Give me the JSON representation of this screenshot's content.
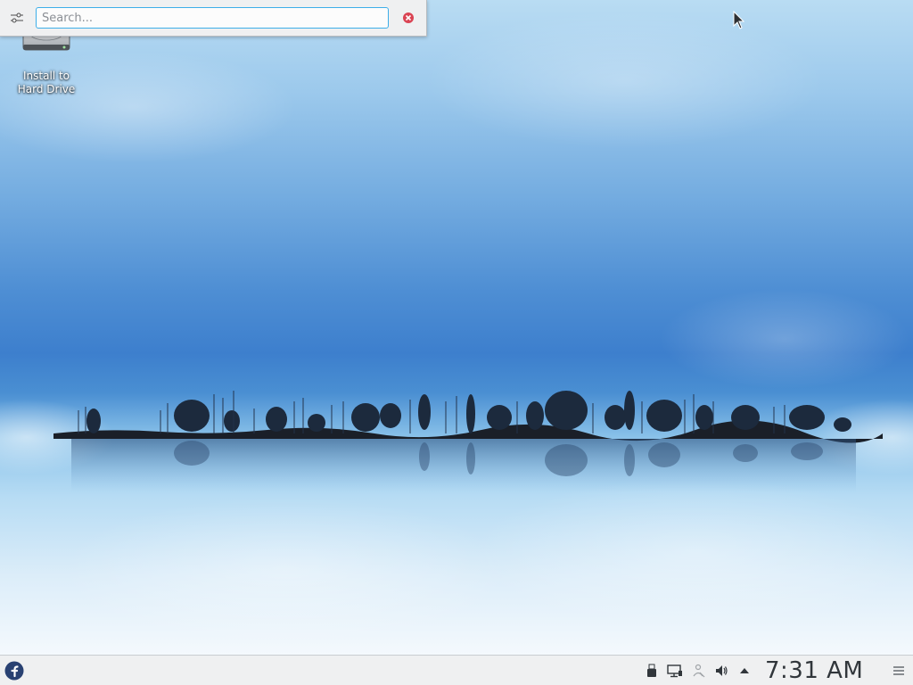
{
  "desktop": {
    "icons": [
      {
        "label": "Install to\nHard Drive",
        "icon": "hard-drive-icon"
      }
    ]
  },
  "krunner": {
    "config_icon": "settings-sliders-icon",
    "search": {
      "placeholder": "Search...",
      "value": ""
    },
    "clear_icon": "close-circle-icon"
  },
  "panel": {
    "launcher_icon": "fedora-logo-icon",
    "tray": [
      {
        "name": "usb-drive-icon"
      },
      {
        "name": "network-icon"
      },
      {
        "name": "kde-connect-icon"
      },
      {
        "name": "volume-icon"
      },
      {
        "name": "expand-tray-arrow-icon"
      }
    ],
    "clock": {
      "time": "7:31 AM"
    },
    "menu_icon": "hamburger-menu-icon"
  },
  "colors": {
    "accent": "#3daee9",
    "panel_bg": "#eff0f1",
    "clear_red": "#da4453",
    "fedora_blue": "#294172"
  }
}
